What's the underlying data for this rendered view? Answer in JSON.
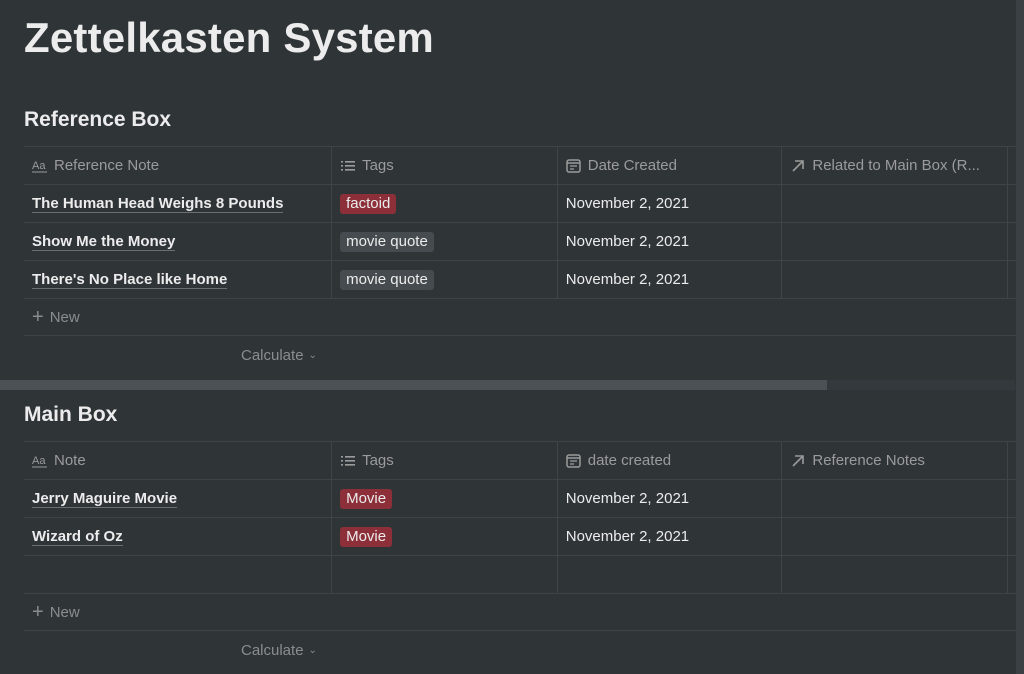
{
  "page": {
    "title": "Zettelkasten System"
  },
  "reference_box": {
    "title": "Reference Box",
    "columns": [
      {
        "label": "Reference Note",
        "icon": "text-aa-icon"
      },
      {
        "label": "Tags",
        "icon": "list-icon"
      },
      {
        "label": "Date Created",
        "icon": "calendar-icon"
      },
      {
        "label": "Related to Main Box (R...",
        "icon": "relation-arrow-icon"
      }
    ],
    "rows": [
      {
        "note": "The Human Head Weighs 8 Pounds",
        "tag": "factoid",
        "tag_color": "#8c2f39",
        "date": "November 2, 2021",
        "related": ""
      },
      {
        "note": "Show Me the Money",
        "tag": "movie quote",
        "tag_color": "#454b4e",
        "date": "November 2, 2021",
        "related": ""
      },
      {
        "note": "There's No Place like Home",
        "tag": "movie quote",
        "tag_color": "#454b4e",
        "date": "November 2, 2021",
        "related": ""
      }
    ],
    "new_label": "New",
    "calculate_label": "Calculate"
  },
  "main_box": {
    "title": "Main Box",
    "columns": [
      {
        "label": "Note",
        "icon": "text-aa-icon"
      },
      {
        "label": "Tags",
        "icon": "list-icon"
      },
      {
        "label": "date created",
        "icon": "calendar-icon"
      },
      {
        "label": "Reference Notes",
        "icon": "relation-arrow-icon"
      }
    ],
    "rows": [
      {
        "note": "Jerry Maguire Movie",
        "tag": "Movie",
        "tag_color": "#8c2f39",
        "date": "November 2, 2021",
        "related": ""
      },
      {
        "note": "Wizard of Oz",
        "tag": "Movie",
        "tag_color": "#8c2f39",
        "date": "November 2, 2021",
        "related": ""
      }
    ],
    "new_label": "New",
    "calculate_label": "Calculate"
  },
  "scrollbar": {
    "horizontal_visible_fraction": 0.81
  }
}
